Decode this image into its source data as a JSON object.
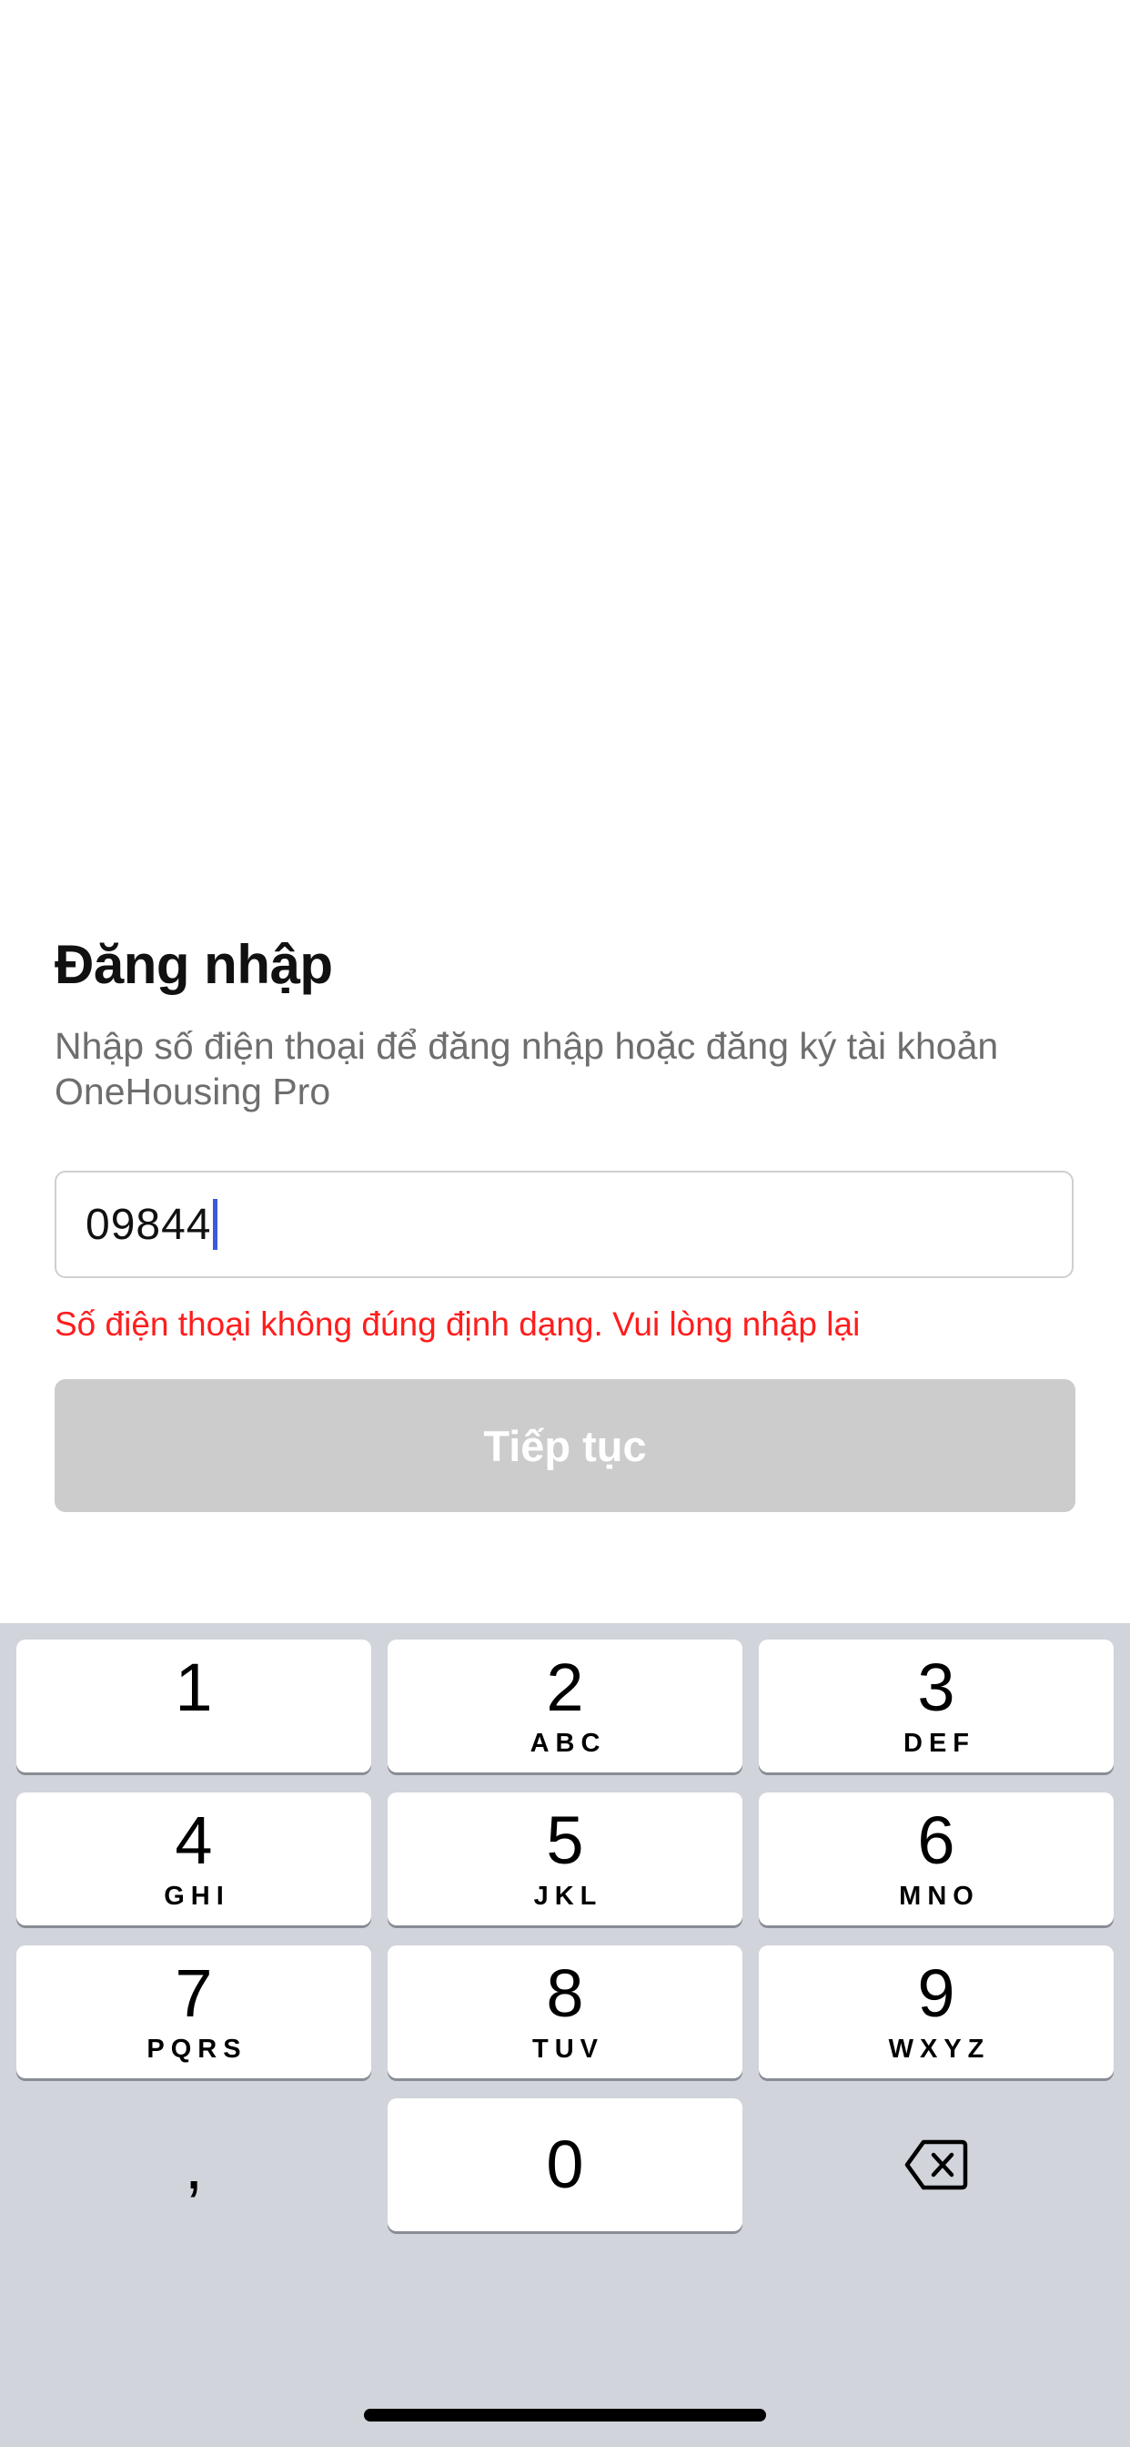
{
  "login": {
    "title": "Đăng nhập",
    "subtitle": "Nhập số điện thoại để đăng nhập hoặc đăng ký tài khoản OneHousing Pro",
    "phone_value": "09844",
    "error_message": "Số điện thoại không đúng định dạng. Vui lòng nhập lại",
    "continue_label": "Tiếp tục"
  },
  "keyboard": {
    "keys": [
      {
        "digit": "1",
        "letters": ""
      },
      {
        "digit": "2",
        "letters": "ABC"
      },
      {
        "digit": "3",
        "letters": "DEF"
      },
      {
        "digit": "4",
        "letters": "GHI"
      },
      {
        "digit": "5",
        "letters": "JKL"
      },
      {
        "digit": "6",
        "letters": "MNO"
      },
      {
        "digit": "7",
        "letters": "PQRS"
      },
      {
        "digit": "8",
        "letters": "TUV"
      },
      {
        "digit": "9",
        "letters": "WXYZ"
      },
      {
        "digit": "0",
        "letters": ""
      }
    ],
    "comma_label": ",",
    "delete_icon": "delete-backspace-icon"
  },
  "colors": {
    "error": "#ff1d1d",
    "button_disabled": "#cccccc",
    "caret": "#3b5bdb",
    "keyboard_bg": "#d1d4da"
  }
}
